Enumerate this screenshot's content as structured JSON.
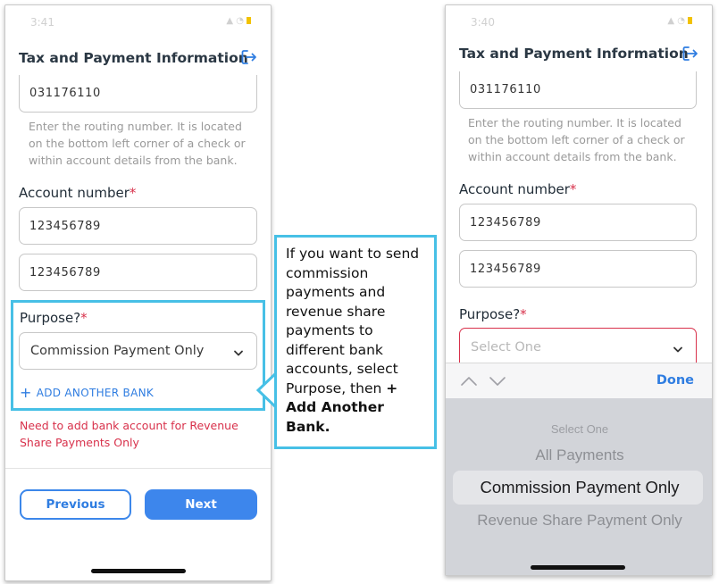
{
  "left_screen": {
    "status_time": "3:41",
    "title": "Tax and Payment Information",
    "routing_value": "031176110",
    "routing_help": "Enter the routing number. It is located on the bottom left corner of a check or within account details from the bank.",
    "account_label": "Account number",
    "required_mark": "*",
    "account_value": "123456789",
    "account_confirm_value": "123456789",
    "purpose_label": "Purpose?",
    "purpose_value": "Commission Payment Only",
    "add_bank_label": "ADD ANOTHER BANK",
    "error_text": "Need to add bank account for Revenue Share Payments Only",
    "previous_label": "Previous",
    "next_label": "Next"
  },
  "right_screen": {
    "status_time": "3:40",
    "title": "Tax and Payment Information",
    "routing_value": "031176110",
    "routing_help": "Enter the routing number. It is located on the bottom left corner of a check or within account details from the bank.",
    "account_label": "Account number",
    "required_mark": "*",
    "account_value": "123456789",
    "account_confirm_value": "123456789",
    "purpose_label": "Purpose?",
    "purpose_placeholder": "Select One",
    "done_label": "Done",
    "picker_options": [
      "Select One",
      "All Payments",
      "Commission Payment Only",
      "Revenue Share Payment Only"
    ]
  },
  "callout": {
    "text_plain": "If you want to send commission payments and revenue share payments to different bank accounts, select Purpose, then ",
    "text_bold": "+ Add Another Bank."
  },
  "colors": {
    "accent_blue": "#3d86ec",
    "required_red": "#d8314b",
    "highlight_cyan": "#47c0e6"
  }
}
